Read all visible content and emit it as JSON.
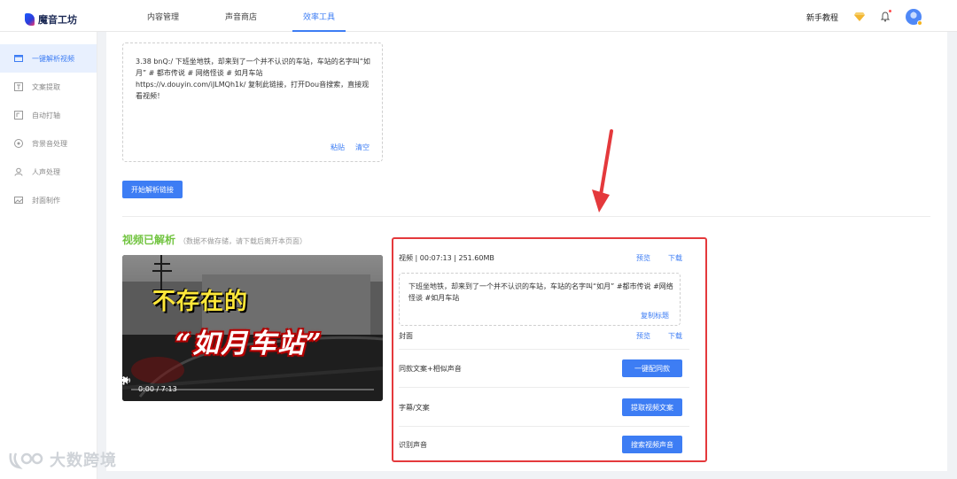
{
  "app": {
    "name": "魔音工坊"
  },
  "nav": {
    "tabs": [
      "内容管理",
      "声音商店",
      "效率工具"
    ]
  },
  "header": {
    "tutorial": "新手教程"
  },
  "sidebar": {
    "items": [
      "一键解析视频",
      "文案提取",
      "自动打轴",
      "背景音处理",
      "人声处理",
      "封面制作"
    ]
  },
  "link_input": {
    "value": "3.38 bnQ:/ 下班坐地铁，却来到了一个并不认识的车站，车站的名字叫“如月” # 都市传说 # 网络怪谈 # 如月车站  https://v.douyin.com/iJLMQh1k/ 复制此链接，打开Dou音搜索，直接观看视频！",
    "paste": "粘贴",
    "clear": "清空"
  },
  "parse_button": "开始解析链接",
  "result": {
    "title": "视频已解析",
    "note": "（数据不做存储，请下载后离开本页面）"
  },
  "video": {
    "overlay_line1": "不存在的",
    "overlay_line2": "“如月车站”",
    "time": "0:00 / 7:13",
    "progress": 0.0
  },
  "panel": {
    "video_info": "视频 | 00:07:13 | 251.60MB",
    "preview": "预览",
    "download": "下载",
    "caption": "下班坐地铁，却来到了一个并不认识的车站，车站的名字叫“如月” #都市传说 #网络怪谈 #如月车站",
    "copy_title": "复制标题",
    "cover_label": "封面",
    "same_text_label": "同款文案+相似声音",
    "same_text_btn": "一键配同款",
    "subtitle_label": "字幕/文案",
    "subtitle_btn": "提取视频文案",
    "voice_label": "识别声音",
    "voice_btn": "搜索视频声音"
  },
  "watermark": {
    "text": "大数跨境"
  },
  "colors": {
    "accent": "#3d7df4",
    "highlight": "#e4393c",
    "success": "#72c441"
  }
}
